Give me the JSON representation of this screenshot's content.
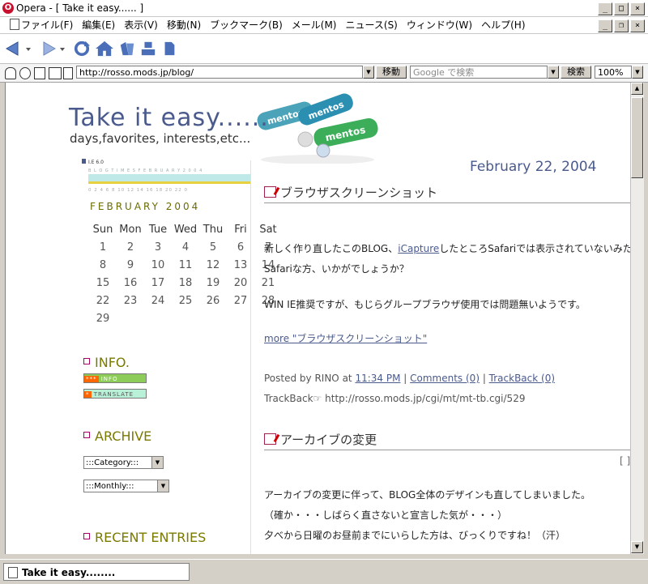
{
  "window": {
    "title": "Opera - [ Take it easy...... ]",
    "app_icon": "opera-icon"
  },
  "menu": [
    "ファイル(F)",
    "編集(E)",
    "表示(V)",
    "移動(N)",
    "ブックマーク(B)",
    "メール(M)",
    "ニュース(S)",
    "ウィンドウ(W)",
    "ヘルプ(H)"
  ],
  "toolbar": {
    "icons": [
      "back-icon",
      "forward-icon",
      "reload-icon",
      "home-icon",
      "hotlist-icon",
      "print-icon",
      "document-icon"
    ]
  },
  "address": {
    "url": "http://rosso.mods.jp/blog/",
    "go_label": "移動",
    "search_placeholder": "Google で検索",
    "search_label": "検索",
    "zoom": "100%"
  },
  "site": {
    "title": "Take it easy......",
    "subtitle": "days,favorites, interests,etc..."
  },
  "blogtimes": {
    "ie_label": "I.E 6.0",
    "label": "B L O G T I M E S   F E B R U A R Y   2 0 0 4",
    "ticks": "0 2 4 6 8 10 12 14 16 18 20 22 0"
  },
  "calendar": {
    "title": "FEBRUARY 2004",
    "days": [
      "Sun",
      "Mon",
      "Tue",
      "Wed",
      "Thu",
      "Fri",
      "Sat"
    ],
    "weeks": [
      [
        "1",
        "2",
        "3",
        "4",
        "5",
        "6",
        "7"
      ],
      [
        "8",
        "9",
        "10",
        "11",
        "12",
        "13",
        "14"
      ],
      [
        "15",
        "16",
        "17",
        "18",
        "19",
        "20",
        "21"
      ],
      [
        "22",
        "23",
        "24",
        "25",
        "26",
        "27",
        "28"
      ],
      [
        "29",
        "",
        "",
        "",
        "",
        "",
        ""
      ]
    ]
  },
  "sidebar": {
    "info_heading": "INFO.",
    "info_badge": "INFO",
    "translate_badge": "TRANSLATE",
    "archive_heading": "ARCHIVE",
    "category_select": ":::Category:::",
    "monthly_select": ":::Monthly:::",
    "recent_heading": "RECENT ENTRIES"
  },
  "posts": {
    "date": "February 22, 2004",
    "first": {
      "title": "ブラウザスクリーンショット",
      "line1_pre": "新しく作り直したこのBLOG、",
      "line1_link": "iCapture",
      "line1_post": "したところSafariでは表示されていないみたい",
      "line2": "Safariな方、いかがでしょうか？",
      "line3": "WIN IE推奨ですが、もじらグループブラウザ使用では問題無いようです。",
      "more": "more \"ブラウザスクリーンショット\"",
      "posted_by": "Posted by RINO at",
      "time": "11:34 PM",
      "comments": "Comments (0)",
      "trackback": "TrackBack (0)",
      "trackback_label": "TrackBack",
      "trackback_url": "http://rosso.mods.jp/cgi/mt/mt-tb.cgi/529"
    },
    "second": {
      "title": "アーカイブの変更",
      "line1": "アーカイブの変更に伴って、BLOG全体のデザインも直してしまいました。",
      "line2": "（確か・・・しばらく直さないと宣言した気が・・・）",
      "line3": "夕べから日曜のお昼前までにいらした方は、びっくりですね！（汗）"
    }
  },
  "status": {
    "tab_title": "Take it easy........"
  }
}
